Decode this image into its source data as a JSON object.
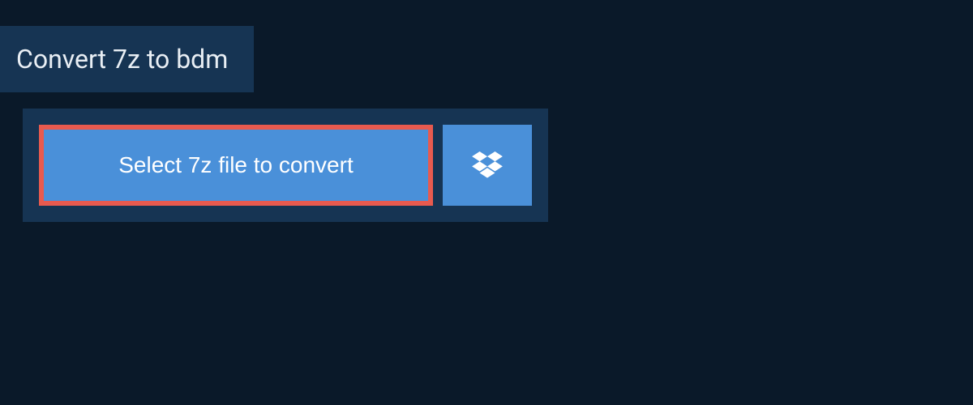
{
  "header": {
    "title": "Convert 7z to bdm"
  },
  "upload": {
    "select_label": "Select 7z file to convert",
    "dropbox_icon": "dropbox"
  },
  "colors": {
    "background": "#0a1929",
    "panel": "#163453",
    "button": "#4a90d9",
    "highlight_border": "#e85a4f",
    "text_light": "#e8eef4",
    "text_white": "#ffffff"
  }
}
